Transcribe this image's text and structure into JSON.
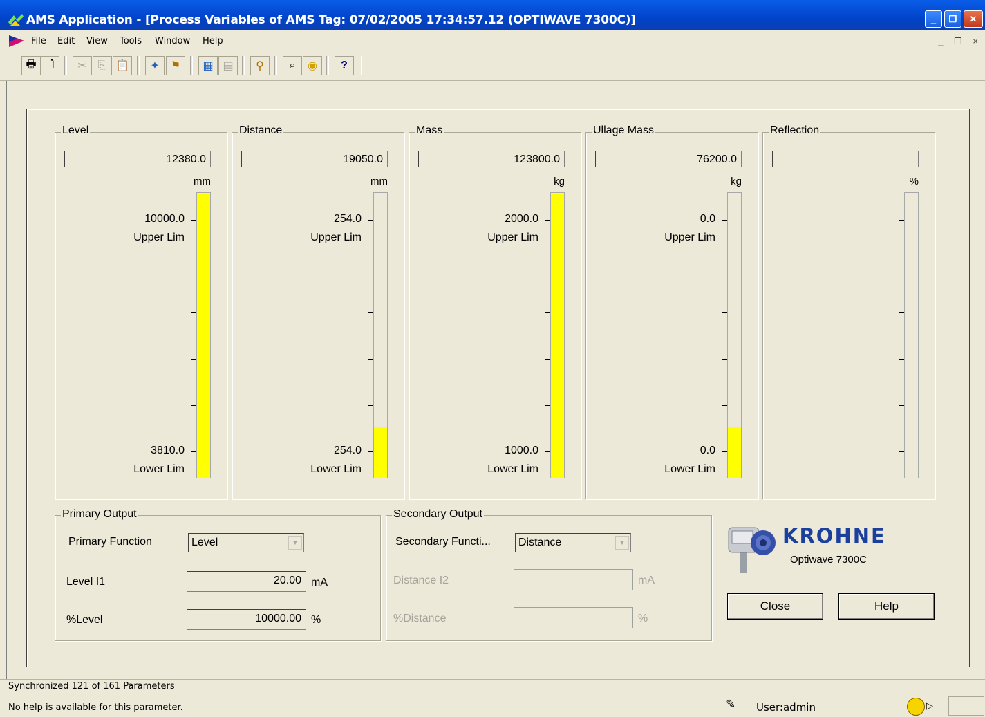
{
  "window": {
    "title": "AMS Application - [Process Variables of AMS Tag: 07/02/2005 17:34:57.12 (OPTIWAVE 7300C)]",
    "controls": {
      "minimize": "_",
      "restore": "❐",
      "close": "✕"
    }
  },
  "menubar": {
    "items": [
      {
        "label": "File",
        "mnemonic": "F"
      },
      {
        "label": "Edit",
        "mnemonic": "E"
      },
      {
        "label": "View",
        "mnemonic": "V"
      },
      {
        "label": "Tools",
        "mnemonic": "T"
      },
      {
        "label": "Window",
        "mnemonic": "W"
      },
      {
        "label": "Help",
        "mnemonic": "H"
      }
    ],
    "mdi_controls": "_ ❐ ×"
  },
  "toolbar": {
    "buttons": [
      {
        "icon": "print-icon",
        "glyph": "🖶",
        "enabled": true
      },
      {
        "icon": "print-preview-icon",
        "glyph": "🗋",
        "enabled": true
      },
      {
        "icon": "cut-icon",
        "glyph": "✂",
        "enabled": false
      },
      {
        "icon": "copy-icon",
        "glyph": "⎘",
        "enabled": false
      },
      {
        "icon": "paste-icon",
        "glyph": "📋",
        "enabled": false
      },
      {
        "icon": "device-tools-icon",
        "glyph": "✦",
        "enabled": true
      },
      {
        "icon": "device-person-icon",
        "glyph": "⚑",
        "enabled": true
      },
      {
        "icon": "calendar-icon",
        "glyph": "▦",
        "enabled": true
      },
      {
        "icon": "audit-icon",
        "glyph": "▤",
        "enabled": false
      },
      {
        "icon": "user-icon",
        "glyph": "⚲",
        "enabled": true
      },
      {
        "icon": "find-icon",
        "glyph": "⌕",
        "enabled": true
      },
      {
        "icon": "alert-icon",
        "glyph": "◉",
        "enabled": true
      },
      {
        "icon": "context-help-icon",
        "glyph": "?",
        "enabled": true
      }
    ]
  },
  "gauges": [
    {
      "title": "Level",
      "value": "12380.0",
      "unit": "mm",
      "upper_value": "10000.0",
      "upper_label": "Upper Lim",
      "lower_value": "3810.0",
      "lower_label": "Lower Lim",
      "fill_fraction": 1.0
    },
    {
      "title": "Distance",
      "value": "19050.0",
      "unit": "mm",
      "upper_value": "254.0",
      "upper_label": "Upper Lim",
      "lower_value": "254.0",
      "lower_label": "Lower Lim",
      "fill_fraction": 0.18
    },
    {
      "title": "Mass",
      "value": "123800.0",
      "unit": "kg",
      "upper_value": "2000.0",
      "upper_label": "Upper Lim",
      "lower_value": "1000.0",
      "lower_label": "Lower Lim",
      "fill_fraction": 1.0
    },
    {
      "title": "Ullage Mass",
      "value": "76200.0",
      "unit": "kg",
      "upper_value": "0.0",
      "upper_label": "Upper Lim",
      "lower_value": "0.0",
      "lower_label": "Lower Lim",
      "fill_fraction": 0.18
    },
    {
      "title": "Reflection",
      "value": "",
      "unit": "%",
      "upper_value": "",
      "upper_label": "",
      "lower_value": "",
      "lower_label": "",
      "fill_fraction": 0
    }
  ],
  "primary_output": {
    "title": "Primary Output",
    "function_label": "Primary Function",
    "function_value": "Level",
    "current_label": "Level I1",
    "current_value": "20.00",
    "current_unit": "mA",
    "percent_label": "%Level",
    "percent_value": "10000.00",
    "percent_unit": "%"
  },
  "secondary_output": {
    "title": "Secondary Output",
    "function_label": "Secondary Functi...",
    "function_value": "Distance",
    "current_label": "Distance I2",
    "current_value": "",
    "current_unit": "mA",
    "percent_label": "%Distance",
    "percent_value": "",
    "percent_unit": "%"
  },
  "brand": {
    "name": "KROHNE",
    "model": "Optiwave 7300C",
    "color": "#1a3f9c"
  },
  "buttons": {
    "close": "Close",
    "help": "Help"
  },
  "status": {
    "sync": "Synchronized 121 of 161 Parameters",
    "help": "No help is available for this parameter.",
    "user": "User:admin"
  },
  "colors": {
    "bar_fill": "#ffff00",
    "titlebar": "#0a5ee8",
    "face": "#ece9d8"
  }
}
